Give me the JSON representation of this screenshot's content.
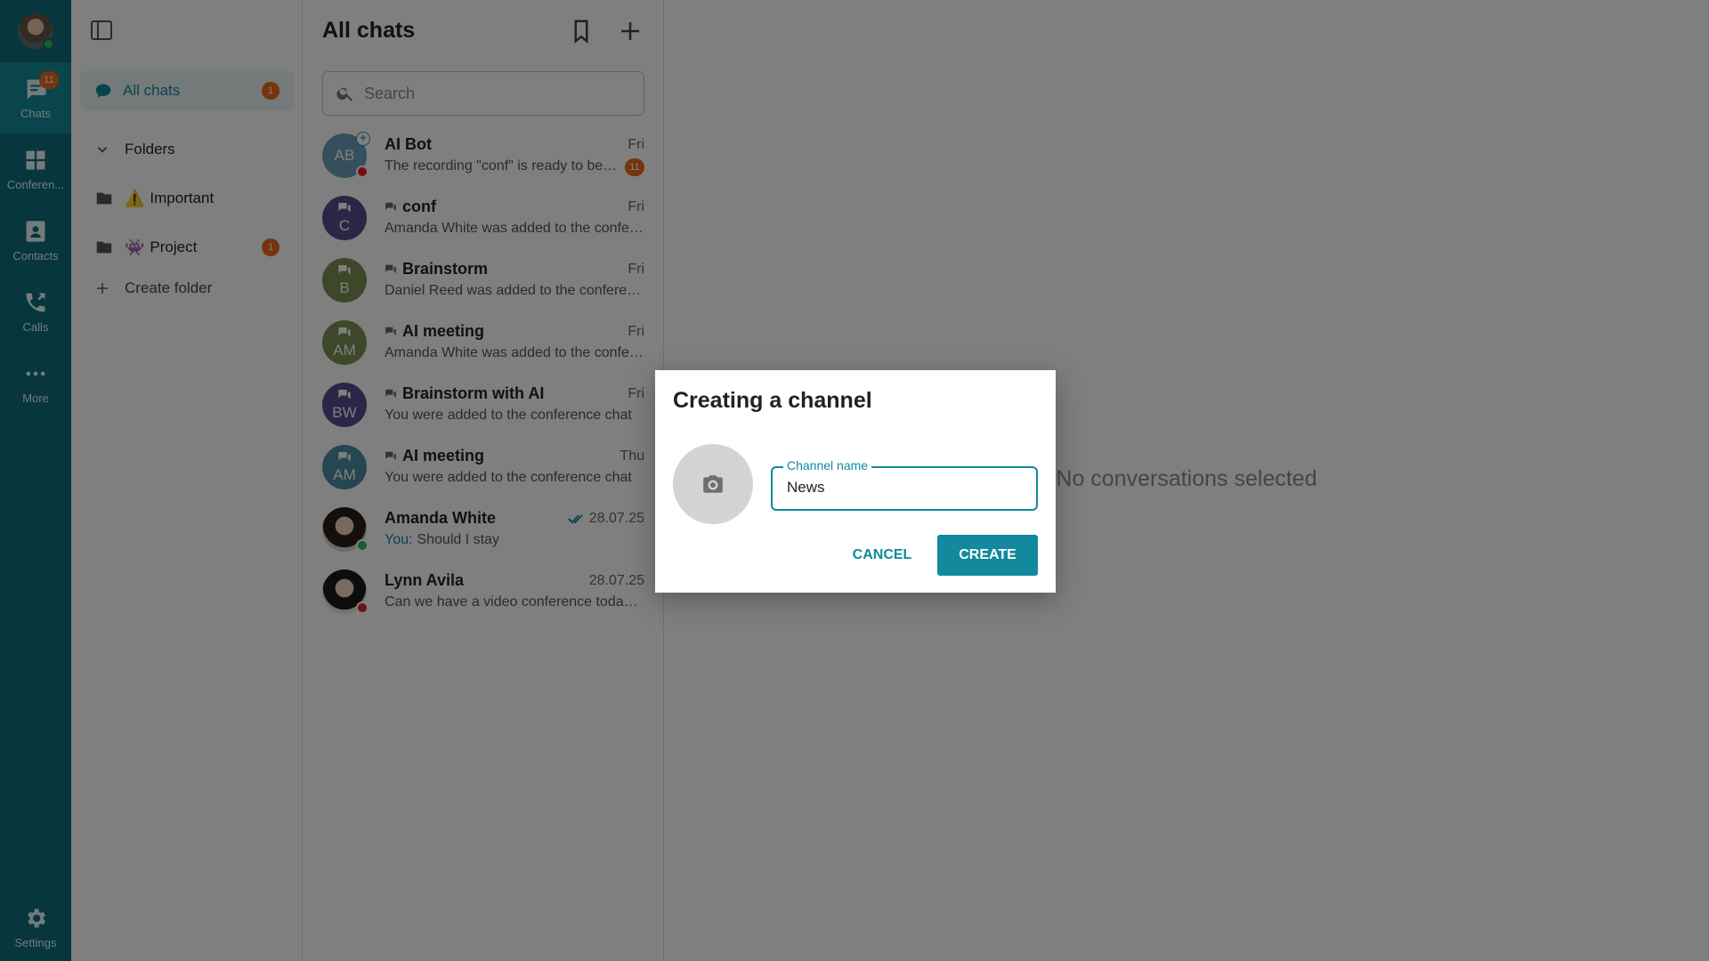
{
  "rail": {
    "items": [
      {
        "label": "Chats",
        "icon": "chat-icon",
        "badge": "11"
      },
      {
        "label": "Conferen...",
        "icon": "conference-icon"
      },
      {
        "label": "Contacts",
        "icon": "contacts-icon"
      },
      {
        "label": "Calls",
        "icon": "calls-icon"
      },
      {
        "label": "More",
        "icon": "more-icon"
      },
      {
        "label": "Settings",
        "icon": "gear-icon"
      }
    ]
  },
  "folders": {
    "all_chats": {
      "label": "All chats",
      "badge": "1"
    },
    "folders_label": "Folders",
    "items": [
      {
        "emoji": "⚠️",
        "label": "Important"
      },
      {
        "emoji": "👾",
        "label": "Project",
        "badge": "1"
      }
    ],
    "create_label": "Create folder"
  },
  "chatlist": {
    "title": "All chats",
    "search_placeholder": "Search",
    "chats": [
      {
        "initials": "AB",
        "name": "AI Bot",
        "time": "Fri",
        "preview": "The recording \"conf\" is ready to be t...",
        "unread": "11",
        "color": "#6a9eb8"
      },
      {
        "initials": "C",
        "name": "conf",
        "time": "Fri",
        "preview": "Amanda White was added to the confer...",
        "color": "#5a4a8f"
      },
      {
        "initials": "B",
        "name": "Brainstorm",
        "time": "Fri",
        "preview": "Daniel Reed was added to the conferen...",
        "color": "#7d8f50"
      },
      {
        "initials": "AM",
        "name": "AI meeting",
        "time": "Fri",
        "preview": "Amanda White was added to the confer...",
        "color": "#7d8f50"
      },
      {
        "initials": "BW",
        "name": "Brainstorm with AI",
        "time": "Fri",
        "preview": "You were added to the conference chat",
        "color": "#5a4a8f"
      },
      {
        "initials": "AM",
        "name": "AI meeting",
        "time": "Thu",
        "preview": "You were added to the conference chat",
        "color": "#4a8ea3"
      },
      {
        "name": "Amanda White",
        "time": "28.07.25",
        "you_label": "You:",
        "preview": "Should I stay"
      },
      {
        "name": "Lynn Avila",
        "time": "28.07.25",
        "preview": "Can we have a video conference today ..."
      }
    ]
  },
  "main": {
    "empty_text": "No conversations selected"
  },
  "dialog": {
    "title": "Creating a channel",
    "field_label": "Channel name",
    "field_value": "News",
    "cancel_label": "CANCEL",
    "create_label": "CREATE"
  },
  "colors": {
    "accent": "#12899d",
    "rail": "#0e6c78",
    "badge": "#ea6a1b",
    "online": "#2cc14e",
    "busy": "#e0242a"
  }
}
